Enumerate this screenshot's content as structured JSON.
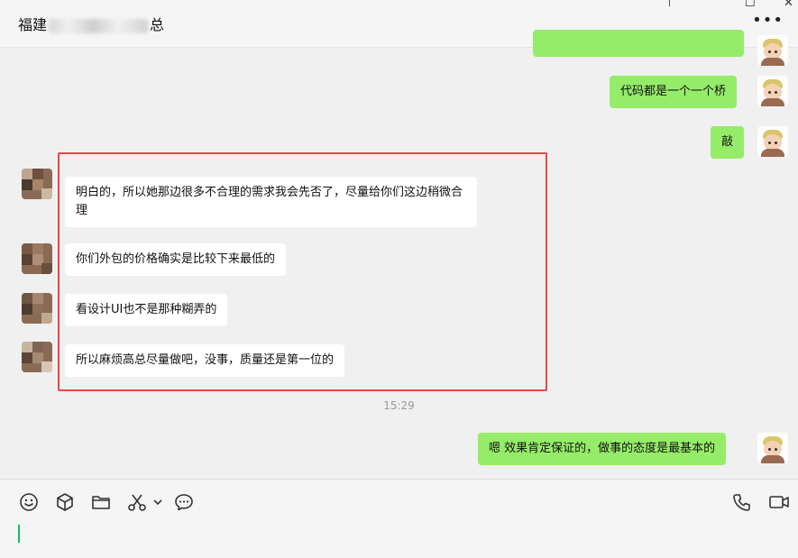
{
  "header": {
    "title_prefix": "福建",
    "title_suffix": "总",
    "more_label": "•••",
    "pin_glyph": "⊤",
    "maximize_glyph": "☐",
    "close_glyph": "✕"
  },
  "messages": [
    {
      "from": "me",
      "text": "代码都是一个一个桥"
    },
    {
      "from": "me",
      "text": "敲"
    },
    {
      "from": "other",
      "text": "明白的，所以她那边很多不合理的需求我会先否了，尽量给你们这边稍微合理"
    },
    {
      "from": "other",
      "text": "你们外包的价格确实是比较下来最低的"
    },
    {
      "from": "other",
      "text": "看设计UI也不是那种糊弄的"
    },
    {
      "from": "other",
      "text": "所以麻烦高总尽量做吧，没事，质量还是第一位的"
    },
    {
      "from": "me",
      "text": "嗯 效果肯定保证的，做事的态度是最基本的"
    }
  ],
  "timestamp": "15:29",
  "toolbar": {
    "icons": [
      "emoji-icon",
      "package-icon",
      "folder-icon",
      "scissors-icon",
      "chat-history-icon",
      "phone-icon",
      "video-call-icon"
    ],
    "accent": "#07c160"
  },
  "colors": {
    "my_bubble": "#95ec69",
    "other_bubble": "#ffffff",
    "highlight_border": "#e94848"
  }
}
